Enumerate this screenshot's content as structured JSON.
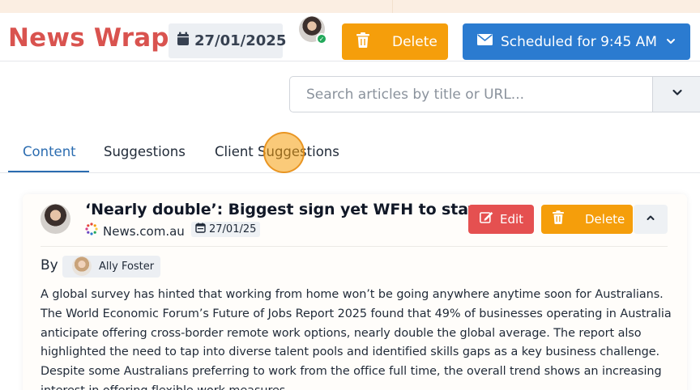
{
  "header": {
    "brand": "News Wrap",
    "date": "27/01/2025",
    "delete_label": "Delete",
    "schedule_label": "Scheduled for 9:45 AM"
  },
  "search": {
    "placeholder": "Search articles by title or URL..."
  },
  "tabs": [
    {
      "label": "Content",
      "active": true
    },
    {
      "label": "Suggestions",
      "active": false
    },
    {
      "label": "Client Suggestions",
      "active": false
    }
  ],
  "article": {
    "headline": "‘Nearly double’: Biggest sign yet WFH to stay",
    "source": "News.com.au",
    "date": "27/01/25",
    "edit_label": "Edit",
    "delete_label": "Delete",
    "by_label": "By",
    "author": "Ally Foster",
    "body": "A global survey has hinted that working from home won’t be going anywhere anytime soon for Australians. The World Economic Forum’s Future of Jobs Report 2025 found that 49% of businesses operating in Australia anticipate offering cross-border remote work options, nearly double the global average. The report also highlighted the need to tap into diverse talent pools and identified skills gaps as a key business challenge. Despite some Australians preferring to work from the office full time, the overall trend shows an increasing interest in offering flexible work measures."
  },
  "icons": {
    "calendar": "calendar-icon",
    "trash": "trash-icon",
    "envelope": "envelope-icon",
    "chevron_down": "chevron-down-icon",
    "chevron_up": "chevron-up-icon",
    "edit": "edit-icon",
    "source_logo": "news-logo-icon",
    "check": "check-icon"
  },
  "colors": {
    "brand": "#d9534f",
    "delete": "#f59e0b",
    "schedule": "#2b7bd0",
    "edit": "#e55050",
    "active_tab": "#2b6cb0",
    "online": "#22a85a"
  }
}
